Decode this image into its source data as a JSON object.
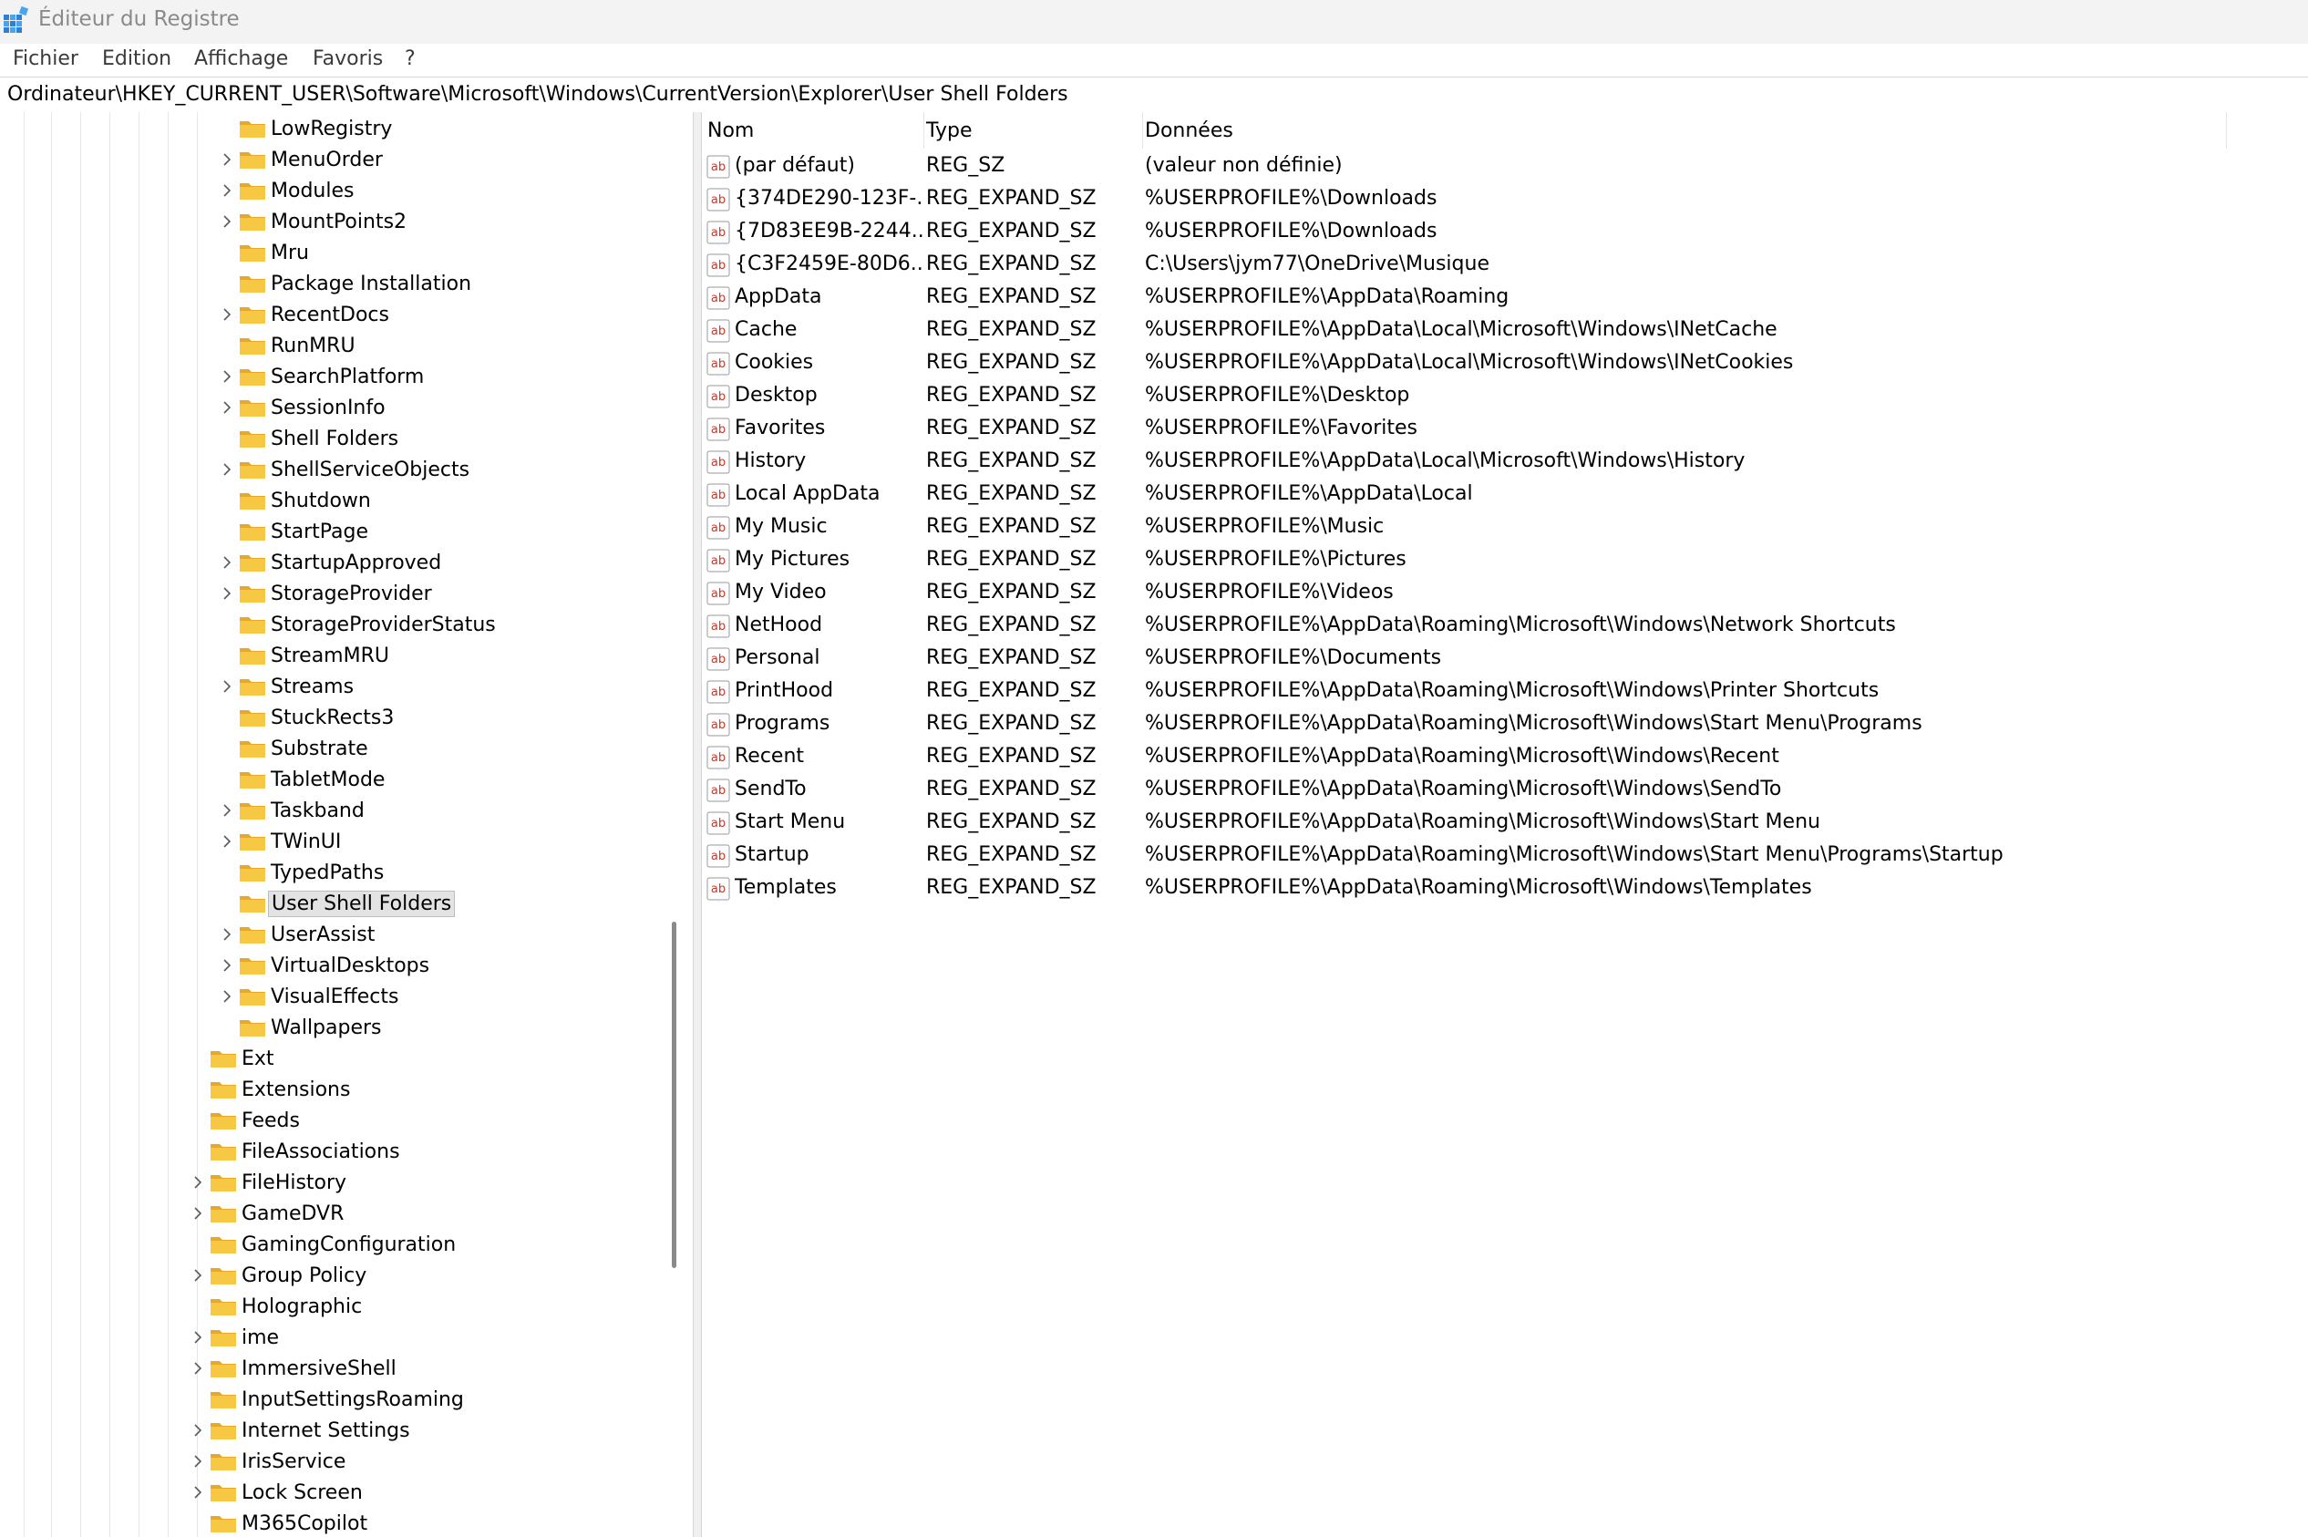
{
  "window": {
    "title": "Éditeur du Registre",
    "icon": "registry-editor-icon"
  },
  "menu": {
    "items": [
      "Fichier",
      "Edition",
      "Affichage",
      "Favoris",
      "?"
    ]
  },
  "address": {
    "path": "Ordinateur\\HKEY_CURRENT_USER\\Software\\Microsoft\\Windows\\CurrentVersion\\Explorer\\User Shell Folders"
  },
  "tree": {
    "items": [
      {
        "label": "LowRegistry",
        "level": 2,
        "expandable": false
      },
      {
        "label": "MenuOrder",
        "level": 2,
        "expandable": true
      },
      {
        "label": "Modules",
        "level": 2,
        "expandable": true
      },
      {
        "label": "MountPoints2",
        "level": 2,
        "expandable": true
      },
      {
        "label": "Mru",
        "level": 2,
        "expandable": false
      },
      {
        "label": "Package Installation",
        "level": 2,
        "expandable": false
      },
      {
        "label": "RecentDocs",
        "level": 2,
        "expandable": true
      },
      {
        "label": "RunMRU",
        "level": 2,
        "expandable": false
      },
      {
        "label": "SearchPlatform",
        "level": 2,
        "expandable": true
      },
      {
        "label": "SessionInfo",
        "level": 2,
        "expandable": true
      },
      {
        "label": "Shell Folders",
        "level": 2,
        "expandable": false
      },
      {
        "label": "ShellServiceObjects",
        "level": 2,
        "expandable": true
      },
      {
        "label": "Shutdown",
        "level": 2,
        "expandable": false
      },
      {
        "label": "StartPage",
        "level": 2,
        "expandable": false
      },
      {
        "label": "StartupApproved",
        "level": 2,
        "expandable": true
      },
      {
        "label": "StorageProvider",
        "level": 2,
        "expandable": true
      },
      {
        "label": "StorageProviderStatus",
        "level": 2,
        "expandable": false
      },
      {
        "label": "StreamMRU",
        "level": 2,
        "expandable": false
      },
      {
        "label": "Streams",
        "level": 2,
        "expandable": true
      },
      {
        "label": "StuckRects3",
        "level": 2,
        "expandable": false
      },
      {
        "label": "Substrate",
        "level": 2,
        "expandable": false
      },
      {
        "label": "TabletMode",
        "level": 2,
        "expandable": false
      },
      {
        "label": "Taskband",
        "level": 2,
        "expandable": true
      },
      {
        "label": "TWinUI",
        "level": 2,
        "expandable": true
      },
      {
        "label": "TypedPaths",
        "level": 2,
        "expandable": false
      },
      {
        "label": "User Shell Folders",
        "level": 2,
        "expandable": false,
        "selected": true
      },
      {
        "label": "UserAssist",
        "level": 2,
        "expandable": true
      },
      {
        "label": "VirtualDesktops",
        "level": 2,
        "expandable": true
      },
      {
        "label": "VisualEffects",
        "level": 2,
        "expandable": true
      },
      {
        "label": "Wallpapers",
        "level": 2,
        "expandable": false
      },
      {
        "label": "Ext",
        "level": 1,
        "expandable": false
      },
      {
        "label": "Extensions",
        "level": 1,
        "expandable": false
      },
      {
        "label": "Feeds",
        "level": 1,
        "expandable": false
      },
      {
        "label": "FileAssociations",
        "level": 1,
        "expandable": false
      },
      {
        "label": "FileHistory",
        "level": 1,
        "expandable": true
      },
      {
        "label": "GameDVR",
        "level": 1,
        "expandable": true
      },
      {
        "label": "GamingConfiguration",
        "level": 1,
        "expandable": false
      },
      {
        "label": "Group Policy",
        "level": 1,
        "expandable": true
      },
      {
        "label": "Holographic",
        "level": 1,
        "expandable": false
      },
      {
        "label": "ime",
        "level": 1,
        "expandable": true
      },
      {
        "label": "ImmersiveShell",
        "level": 1,
        "expandable": true
      },
      {
        "label": "InputSettingsRoaming",
        "level": 1,
        "expandable": false
      },
      {
        "label": "Internet Settings",
        "level": 1,
        "expandable": true
      },
      {
        "label": "IrisService",
        "level": 1,
        "expandable": true
      },
      {
        "label": "Lock Screen",
        "level": 1,
        "expandable": true
      },
      {
        "label": "M365Copilot",
        "level": 1,
        "expandable": false
      }
    ]
  },
  "list": {
    "columns": [
      "Nom",
      "Type",
      "Données"
    ],
    "icon": "string-value-icon",
    "rows": [
      {
        "name": "(par défaut)",
        "type": "REG_SZ",
        "data": "(valeur non définie)"
      },
      {
        "name": "{374DE290-123F-...",
        "type": "REG_EXPAND_SZ",
        "data": "%USERPROFILE%\\Downloads"
      },
      {
        "name": "{7D83EE9B-2244...",
        "type": "REG_EXPAND_SZ",
        "data": "%USERPROFILE%\\Downloads"
      },
      {
        "name": "{C3F2459E-80D6...",
        "type": "REG_EXPAND_SZ",
        "data": "C:\\Users\\jym77\\OneDrive\\Musique"
      },
      {
        "name": "AppData",
        "type": "REG_EXPAND_SZ",
        "data": "%USERPROFILE%\\AppData\\Roaming"
      },
      {
        "name": "Cache",
        "type": "REG_EXPAND_SZ",
        "data": "%USERPROFILE%\\AppData\\Local\\Microsoft\\Windows\\INetCache"
      },
      {
        "name": "Cookies",
        "type": "REG_EXPAND_SZ",
        "data": "%USERPROFILE%\\AppData\\Local\\Microsoft\\Windows\\INetCookies"
      },
      {
        "name": "Desktop",
        "type": "REG_EXPAND_SZ",
        "data": "%USERPROFILE%\\Desktop"
      },
      {
        "name": "Favorites",
        "type": "REG_EXPAND_SZ",
        "data": "%USERPROFILE%\\Favorites"
      },
      {
        "name": "History",
        "type": "REG_EXPAND_SZ",
        "data": "%USERPROFILE%\\AppData\\Local\\Microsoft\\Windows\\History"
      },
      {
        "name": "Local AppData",
        "type": "REG_EXPAND_SZ",
        "data": "%USERPROFILE%\\AppData\\Local"
      },
      {
        "name": "My Music",
        "type": "REG_EXPAND_SZ",
        "data": "%USERPROFILE%\\Music"
      },
      {
        "name": "My Pictures",
        "type": "REG_EXPAND_SZ",
        "data": "%USERPROFILE%\\Pictures"
      },
      {
        "name": "My Video",
        "type": "REG_EXPAND_SZ",
        "data": "%USERPROFILE%\\Videos"
      },
      {
        "name": "NetHood",
        "type": "REG_EXPAND_SZ",
        "data": "%USERPROFILE%\\AppData\\Roaming\\Microsoft\\Windows\\Network Shortcuts"
      },
      {
        "name": "Personal",
        "type": "REG_EXPAND_SZ",
        "data": "%USERPROFILE%\\Documents"
      },
      {
        "name": "PrintHood",
        "type": "REG_EXPAND_SZ",
        "data": "%USERPROFILE%\\AppData\\Roaming\\Microsoft\\Windows\\Printer Shortcuts"
      },
      {
        "name": "Programs",
        "type": "REG_EXPAND_SZ",
        "data": "%USERPROFILE%\\AppData\\Roaming\\Microsoft\\Windows\\Start Menu\\Programs"
      },
      {
        "name": "Recent",
        "type": "REG_EXPAND_SZ",
        "data": "%USERPROFILE%\\AppData\\Roaming\\Microsoft\\Windows\\Recent"
      },
      {
        "name": "SendTo",
        "type": "REG_EXPAND_SZ",
        "data": "%USERPROFILE%\\AppData\\Roaming\\Microsoft\\Windows\\SendTo"
      },
      {
        "name": "Start Menu",
        "type": "REG_EXPAND_SZ",
        "data": "%USERPROFILE%\\AppData\\Roaming\\Microsoft\\Windows\\Start Menu"
      },
      {
        "name": "Startup",
        "type": "REG_EXPAND_SZ",
        "data": "%USERPROFILE%\\AppData\\Roaming\\Microsoft\\Windows\\Start Menu\\Programs\\Startup"
      },
      {
        "name": "Templates",
        "type": "REG_EXPAND_SZ",
        "data": "%USERPROFILE%\\AppData\\Roaming\\Microsoft\\Windows\\Templates"
      }
    ]
  },
  "colors": {
    "folder": "#f7c843",
    "folder_dark": "#e8a92a",
    "icon_red": "#c8382a",
    "selection": "#e3e3e3"
  }
}
